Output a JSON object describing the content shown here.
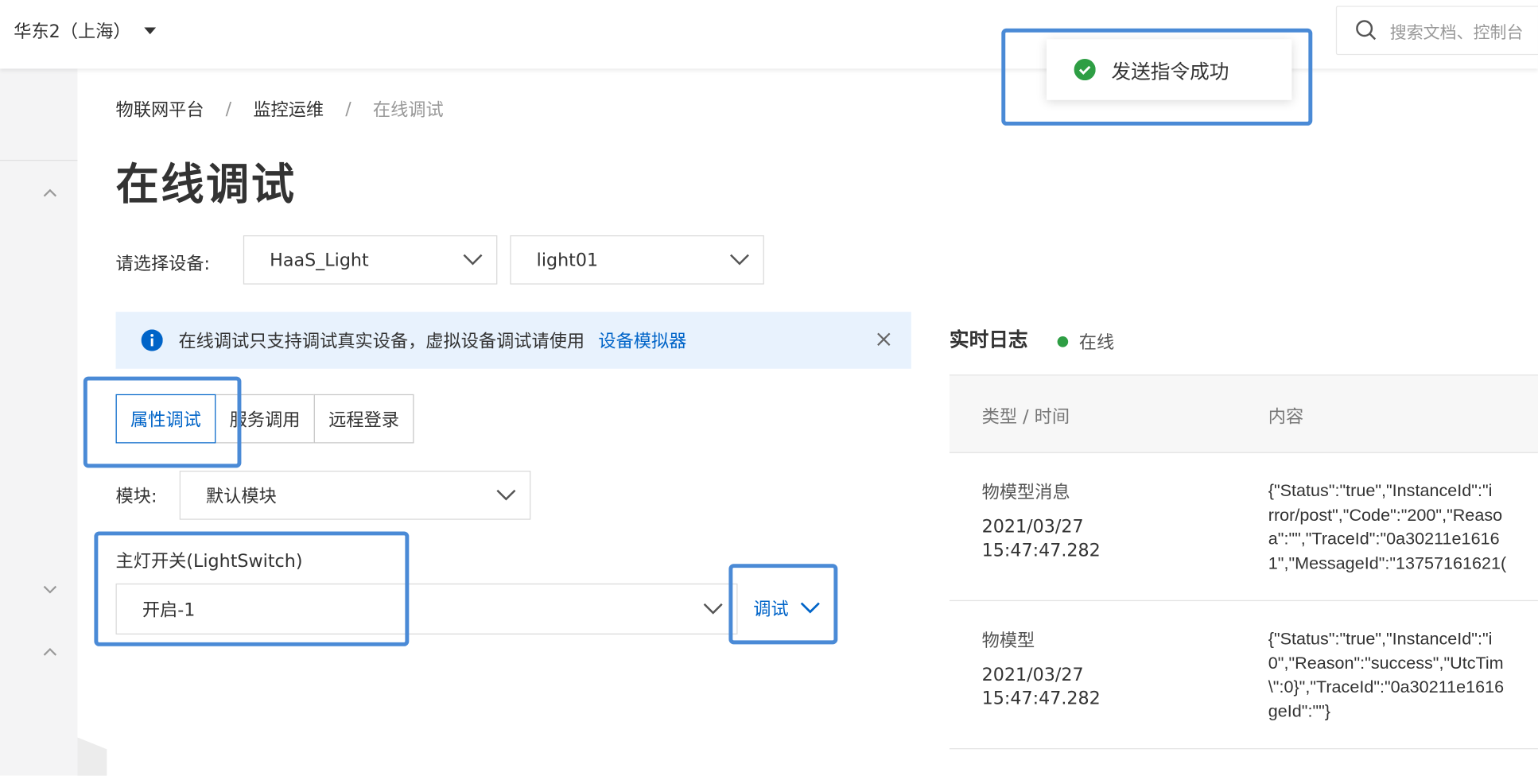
{
  "topbar": {
    "region": "华东2（上海）",
    "search_placeholder": "搜索文档、控制台"
  },
  "toast": {
    "message": "发送指令成功"
  },
  "breadcrumb": {
    "items": [
      "物联网平台",
      "监控运维",
      "在线调试"
    ],
    "separator": "/"
  },
  "page_title": "在线调试",
  "device_select": {
    "label": "请选择设备:",
    "product": "HaaS_Light",
    "device": "light01"
  },
  "alert": {
    "text": "在线调试只支持调试真实设备，虚拟设备调试请使用",
    "link": "设备模拟器"
  },
  "tabs": [
    {
      "label": "属性调试",
      "active": true
    },
    {
      "label": "服务调用",
      "active": false
    },
    {
      "label": "远程登录",
      "active": false
    }
  ],
  "module": {
    "label": "模块:",
    "value": "默认模块"
  },
  "property": {
    "label": "主灯开关(LightSwitch)",
    "value": "开启-1",
    "debug_button": "调试"
  },
  "log": {
    "title": "实时日志",
    "status": "在线",
    "status_color": "#2e9e44",
    "columns": [
      "类型 / 时间",
      "内容"
    ],
    "rows": [
      {
        "type": "物模型消息",
        "time": "2021/03/27 15:47:47.282",
        "content": "{\"Status\":\"true\",\"InstanceId\":\"i\nrror/post\",\"Code\":\"200\",\"Reaso\na\":\"\",\"TraceId\":\"0a30211e1616\n1\",\"MessageId\":\"13757161621(",
        "content_lines": [
          "{\"Status\":\"true\",\"InstanceId\":\"i",
          "rror/post\",\"Code\":\"200\",\"Reaso",
          "a\":\"\",\"TraceId\":\"0a30211e1616",
          "1\",\"MessageId\":\"13757161621("
        ]
      },
      {
        "type": "物模型",
        "time": "2021/03/27 15:47:47.282",
        "content_lines": [
          "{\"Status\":\"true\",\"InstanceId\":\"i",
          "0\",\"Reason\":\"success\",\"UtcTim",
          "\\\":0}\",\"TraceId\":\"0a30211e1616",
          "geId\":\"\"}"
        ]
      }
    ]
  },
  "colors": {
    "accent": "#0064c8",
    "highlight": "#4a8ad6",
    "alert_bg": "#e8f2fd",
    "success": "#2e9e44"
  }
}
